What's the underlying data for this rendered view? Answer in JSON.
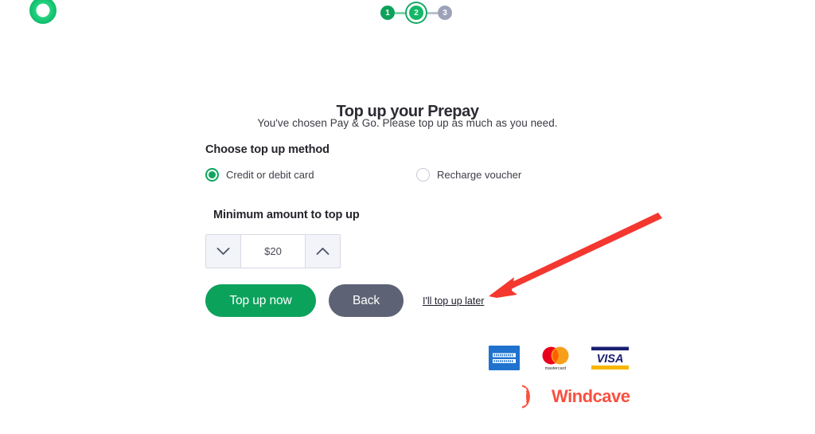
{
  "brand": {
    "logo_icon": "green-ring-logo",
    "logo_color": "#1ccb7a"
  },
  "stepper": {
    "steps": [
      {
        "label": "1",
        "state": "done"
      },
      {
        "label": "2",
        "state": "active"
      },
      {
        "label": "3",
        "state": "todo"
      }
    ],
    "done_color": "#0fa15a",
    "active_color": "#12b866",
    "todo_color": "#9ea2b8"
  },
  "header": {
    "title": "Top up your Prepay",
    "subtitle": "You've chosen Pay & Go. Please top up as much as you need."
  },
  "method": {
    "label": "Choose top up method",
    "options": [
      {
        "label": "Credit or debit card",
        "selected": true
      },
      {
        "label": "Recharge voucher",
        "selected": false
      }
    ],
    "selected_color": "#0ea75d"
  },
  "amount": {
    "label": "Minimum amount to top up",
    "value": "$20",
    "decrease_icon": "chevron-down-icon",
    "increase_icon": "chevron-up-icon"
  },
  "actions": {
    "primary_label": "Top up now",
    "primary_color": "#0ba25c",
    "secondary_label": "Back",
    "secondary_color": "#5d6375",
    "link_label": "I'll top up later"
  },
  "payment_marks": [
    {
      "name": "american-express",
      "label": "AMERICAN EXPRESS"
    },
    {
      "name": "mastercard",
      "label": "mastercard"
    },
    {
      "name": "visa",
      "label": "VISA"
    }
  ],
  "provider": {
    "name": "Windcave",
    "icon": "windcave-shell-icon",
    "color": "#f9503f"
  },
  "annotation": {
    "type": "arrow",
    "color": "#f4372f",
    "points_to": "I'll top up later"
  }
}
